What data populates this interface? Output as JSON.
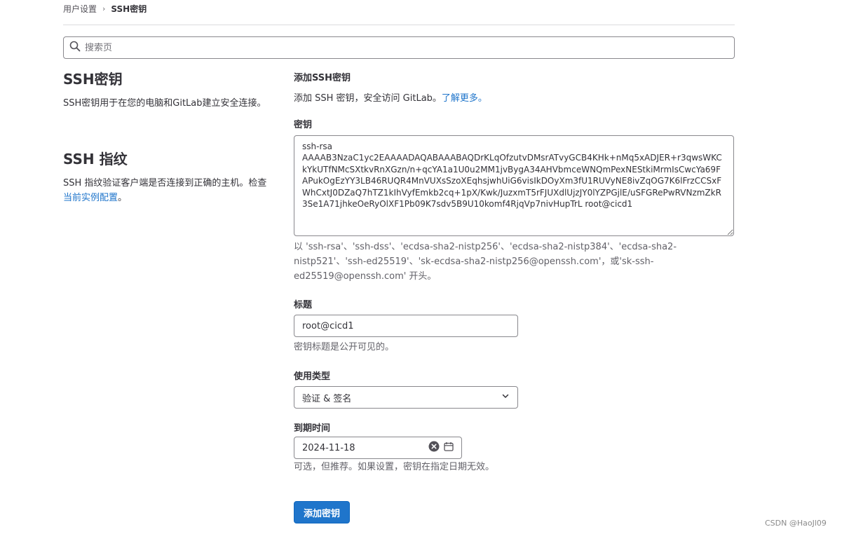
{
  "breadcrumb": {
    "parent": "用户设置",
    "separator": "›",
    "current": "SSH密钥"
  },
  "search": {
    "placeholder": "搜索页"
  },
  "sidebar": {
    "ssh_keys": {
      "title": "SSH密钥",
      "description": "SSH密钥用于在您的电脑和GitLab建立安全连接。"
    },
    "ssh_fingerprints": {
      "title": "SSH 指纹",
      "description_prefix": "SSH 指纹验证客户端是否连接到正确的主机。检查",
      "link_text": "当前实例配置",
      "description_suffix": "。"
    }
  },
  "form": {
    "heading": "添加SSH密钥",
    "description_prefix": "添加 SSH 密钥，安全访问 GitLab。",
    "learn_more_link": "了解更多。",
    "key": {
      "label": "密钥",
      "value": "ssh-rsa\nAAAAB3NzaC1yc2EAAAADAQABAAABAQDrKLqOfzutvDMsrATvyGCB4KHk+nMq5xADJER+r3qwsWKCkYkUTfNMcSXtkvRnXGzn/n+qcYA1a1U0u2MM1jvBygA34AHVbmceWNQmPexNEStkiMrmIsCwcYa69FAPukOgEzYY3LB46RUQR4MnVUXsSzoXEqhsjwhUiG6visIkDOyXm3fU1RUVyNE8ivZqOG7K6lFrzCCSxFWhCxtJ0DZaQ7hTZ1kIhVyfEmkb2cq+1pX/Kwk/JuzxmT5rFJUXdlUjzJY0lYZPGjlE/uSFGRePwRVNzmZkR3Se1A71jhkeOeRyOlXF1Pb09K7sdv5B9U10komf4RjqVp7nivHupTrL root@cicd1",
      "help": "以 'ssh-rsa'、'ssh-dss'、'ecdsa-sha2-nistp256'、'ecdsa-sha2-nistp384'、'ecdsa-sha2-nistp521'、'ssh-ed25519'、'sk-ecdsa-sha2-nistp256@openssh.com'，或'sk-ssh-ed25519@openssh.com' 开头。"
    },
    "title": {
      "label": "标题",
      "value": "root@cicd1",
      "help": "密钥标题是公开可见的。"
    },
    "usage_type": {
      "label": "使用类型",
      "selected": "验证 & 签名"
    },
    "expiration": {
      "label": "到期时间",
      "value": "2024-11-18",
      "help": "可选，但推荐。如果设置，密钥在指定日期无效。"
    },
    "submit_label": "添加密钥"
  },
  "watermark": "CSDN @HaoJl09",
  "colors": {
    "link": "#1f75cb",
    "button": "#1f75cb",
    "border": "#89888d"
  },
  "icons": {
    "search": "search-icon",
    "chevron": "chevron-down-icon",
    "clear": "clear-icon",
    "calendar": "calendar-icon"
  }
}
